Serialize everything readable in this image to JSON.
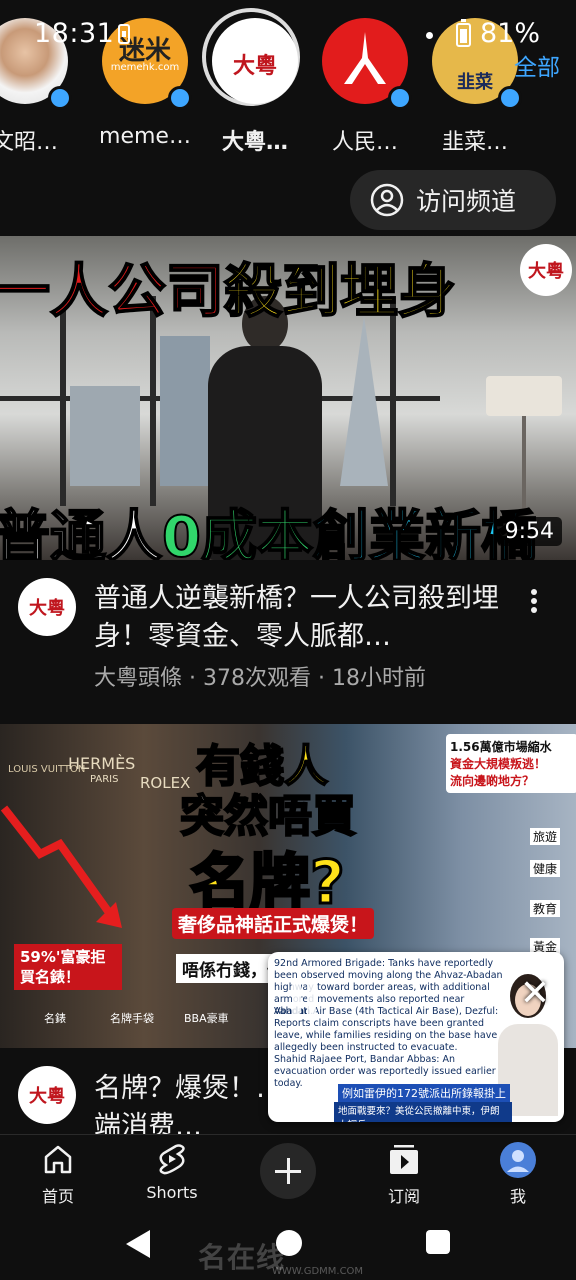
{
  "status_bar": {
    "time": "18:31",
    "battery": "81%"
  },
  "subscriptions": {
    "all_label": "全部",
    "items": [
      {
        "name": "文昭…"
      },
      {
        "name": "meme…",
        "avatar_text": "迷米",
        "avatar_sub": "memehk.com"
      },
      {
        "name": "大粵…",
        "avatar_text": "大粵"
      },
      {
        "name": "人民…"
      },
      {
        "name": "韭菜…",
        "avatar_text": "韭菜"
      }
    ]
  },
  "visit_channel": {
    "label": "访问频道"
  },
  "videos": [
    {
      "thumb_top": "一人公司",
      "thumb_top_2": "殺到埋身",
      "thumb_bottom_1": "普通人",
      "thumb_bottom_2": "0成本",
      "thumb_bottom_3": "創業新橋",
      "badge": "大粵",
      "duration": "9:54",
      "title": "普通人逆襲新橋？一人公司殺到埋身！零資金、零人脈都…",
      "channel": "大粵頭條",
      "views": "378次观看",
      "age": "18小时前"
    },
    {
      "thumb_heading_1": "有錢人",
      "thumb_heading_2": "突然唔買",
      "thumb_heading_3": "名牌?",
      "thumb_banner": "奢侈品神話正式爆煲！",
      "thumb_side_1": "1.56萬億市場縮水",
      "thumb_side_2": "資金大規模叛逃！",
      "thumb_side_3": "流向邊啲地方？",
      "thumb_stat": "59%'富豪拒買名錶！",
      "thumb_note": "唔係冇錢，係要爭驕！",
      "thumb_brands": [
        "LOUIS VUITTON",
        "HERMÈS",
        "PARIS",
        "ROLEX"
      ],
      "thumb_labels": [
        "名錶",
        "名牌手袋",
        "BBA豪車"
      ],
      "thumb_flows": [
        "旅遊",
        "健康",
        "教育",
        "黃金"
      ],
      "badge": "大粵",
      "title": "名牌？爆煲！…時代正式玩完？高端消费…"
    }
  ],
  "mini_player": {
    "lines": [
      "92nd Armored Brigade: Tanks have reportedly been observed moving along the Ahvaz-Abadan highway toward border areas, with additional armored movements also reported near Abadan.",
      "Vahdati Air Base (4th Tactical Air Base), Dezful: Reports claim conscripts have been granted leave, while families residing on the base have allegedly been instructed to evacuate.",
      "Shahid Rajaee Port, Bandar Abbas: An evacuation order was reportedly issued earlier today."
    ],
    "ticker_1": "例如雷伊的172號派出所錄報掛上",
    "ticker_2": "地面戰要來？美從公民撤離中東，伊朗大調兵"
  },
  "bottom_nav": {
    "home": "首页",
    "shorts": "Shorts",
    "subscriptions": "订阅",
    "me": "我"
  },
  "watermark": {
    "text": "名在线",
    "sub": "WWW.GDMM.COM"
  }
}
